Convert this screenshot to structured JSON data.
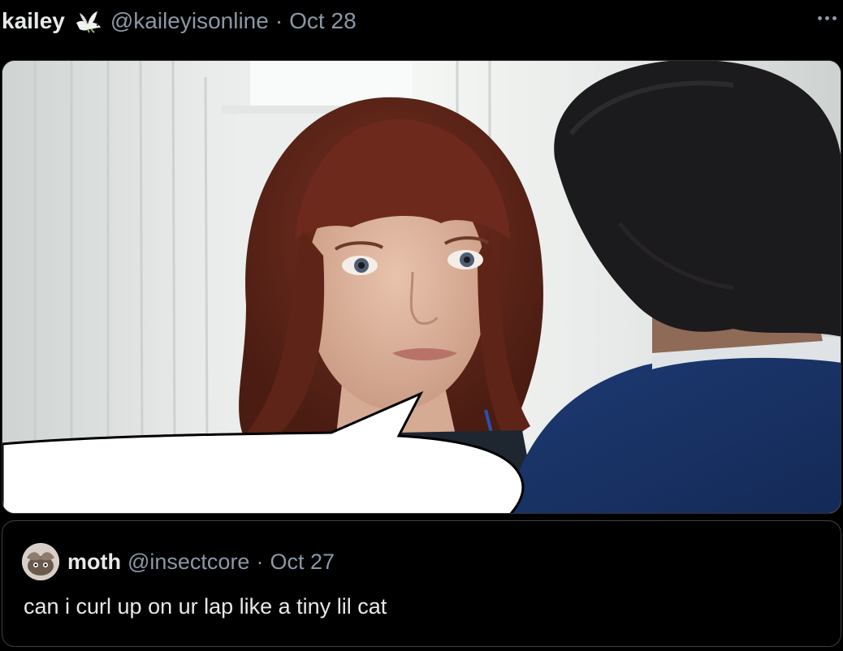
{
  "tweet": {
    "display_name": "kailey",
    "handle": "@kaileyisonline",
    "separator": "·",
    "date": "Oct 28",
    "badge_icon": "dove-icon",
    "more_icon": "ellipsis-icon"
  },
  "media": {
    "kind": "movie still with blank speech bubble",
    "bubble_text": ""
  },
  "quoted_tweet": {
    "display_name": "moth",
    "handle": "@insectcore",
    "separator": "·",
    "date": "Oct 27",
    "text": "can i curl up on ur lap like a tiny lil cat"
  },
  "colors": {
    "background": "#000000",
    "primary_text": "#e7e9ea",
    "secondary_text": "#8b98a5",
    "border": "#2f3336"
  }
}
